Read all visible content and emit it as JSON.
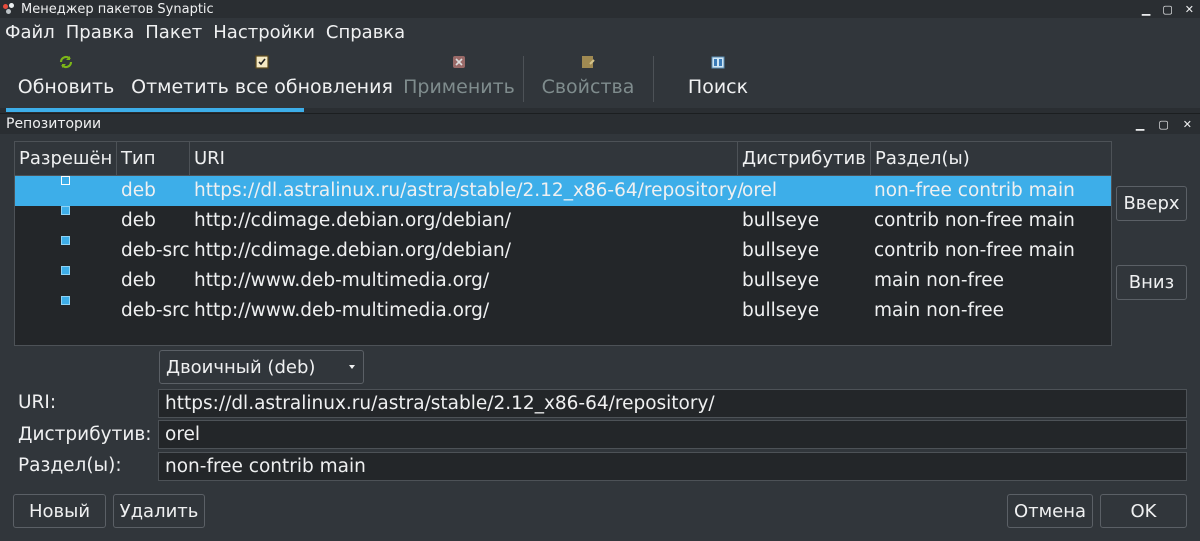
{
  "window": {
    "title": "Менеджер пакетов Synaptic"
  },
  "menu": [
    "Файл",
    "Правка",
    "Пакет",
    "Настройки",
    "Справка"
  ],
  "toolbar": {
    "reload": "Обновить",
    "mark_all": "Отметить все обновления",
    "apply": "Применить",
    "properties": "Свойства",
    "search": "Поиск"
  },
  "dialog": {
    "title": "Репозитории",
    "columns": [
      "Разрешён",
      "Тип",
      "URI",
      "Дистрибутив",
      "Раздел(ы)"
    ],
    "rows": [
      {
        "enabled": false,
        "type": "deb",
        "uri": "https://dl.astralinux.ru/astra/stable/2.12_x86-64/repository/",
        "dist": "orel",
        "sections": "non-free contrib main",
        "selected": true
      },
      {
        "enabled": true,
        "type": "deb",
        "uri": "http://cdimage.debian.org/debian/",
        "dist": "bullseye",
        "sections": "contrib non-free main",
        "selected": false
      },
      {
        "enabled": true,
        "type": "deb-src",
        "uri": "http://cdimage.debian.org/debian/",
        "dist": "bullseye",
        "sections": "contrib non-free main",
        "selected": false
      },
      {
        "enabled": true,
        "type": "deb",
        "uri": "http://www.deb-multimedia.org/",
        "dist": "bullseye",
        "sections": "main non-free",
        "selected": false
      },
      {
        "enabled": true,
        "type": "deb-src",
        "uri": "http://www.deb-multimedia.org/",
        "dist": "bullseye",
        "sections": "main non-free",
        "selected": false
      }
    ],
    "up_button": "Вверх",
    "down_button": "Вниз",
    "type_combo": "Двоичный (deb)",
    "uri_label": "URI:",
    "uri_value": "https://dl.astralinux.ru/astra/stable/2.12_x86-64/repository/",
    "dist_label": "Дистрибутив:",
    "dist_value": "orel",
    "sections_label": "Раздел(ы):",
    "sections_value": "non-free contrib main",
    "new_button": "Новый",
    "delete_button": "Удалить",
    "cancel_button": "Отмена",
    "ok_button": "OK"
  },
  "colors": {
    "accent": "#3daee9",
    "background": "#31363b",
    "base": "#232629"
  }
}
